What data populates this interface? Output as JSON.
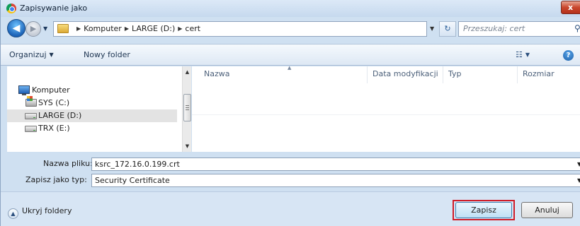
{
  "window": {
    "title": "Zapisywanie jako",
    "close_label": "x"
  },
  "navigation": {
    "back_glyph": "◀",
    "forward_glyph": "▶",
    "breadcrumbs": [
      "Komputer",
      "LARGE (D:)",
      "cert"
    ],
    "breadcrumb_separator": "▶",
    "search_placeholder": "Przeszukaj: cert",
    "refresh_glyph": "↻"
  },
  "toolbar": {
    "organize_label": "Organizuj",
    "new_folder_label": "Nowy folder",
    "view_glyph": "☷",
    "help_glyph": "?"
  },
  "nav_tree": [
    {
      "label": "Komputer",
      "icon": "computer-icon",
      "selected": false
    },
    {
      "label": "SYS (C:)",
      "icon": "drive-sys-icon",
      "selected": false
    },
    {
      "label": "LARGE (D:)",
      "icon": "drive-icon",
      "selected": true
    },
    {
      "label": "TRX (E:)",
      "icon": "drive-icon",
      "selected": false
    }
  ],
  "file_list": {
    "columns": [
      "Nazwa",
      "Data modyfikacji",
      "Typ",
      "Rozmiar"
    ],
    "sort_glyph": "▲"
  },
  "form": {
    "filename_label": "Nazwa pliku:",
    "filename_value": "ksrc_172.16.0.199.crt",
    "filetype_label": "Zapisz jako typ:",
    "filetype_value": "Security Certificate"
  },
  "footer": {
    "hide_folders_label": "Ukryj foldery",
    "save_label": "Zapisz",
    "cancel_label": "Anuluj"
  },
  "colors": {
    "window_frame": "#cfe0f1",
    "close_button": "#c9472d",
    "highlight_border": "#d01c28"
  }
}
